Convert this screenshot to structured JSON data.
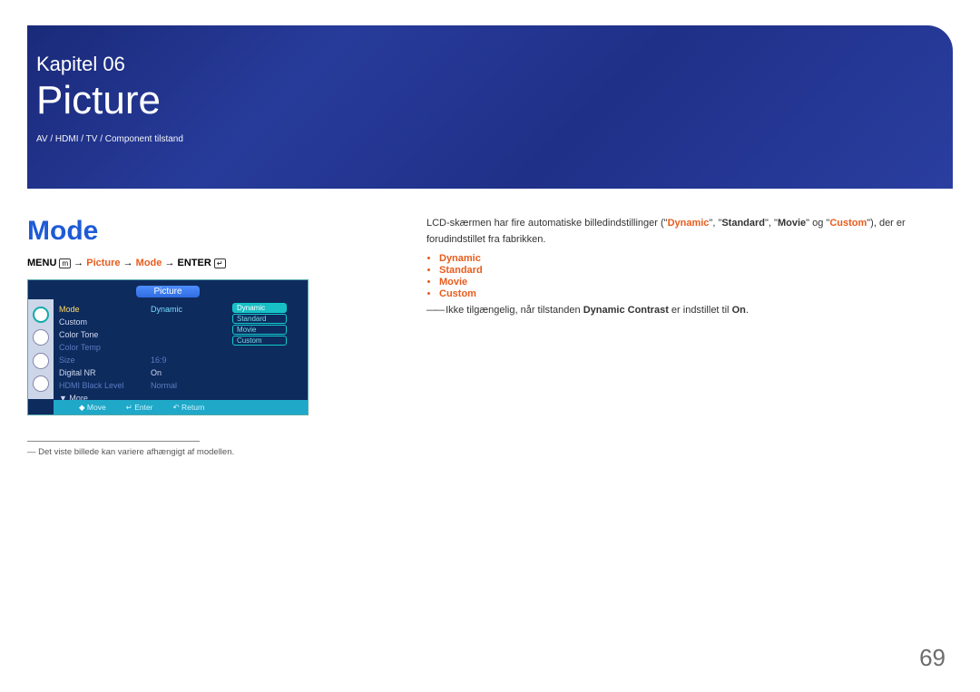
{
  "header": {
    "chapter_label": "Kapitel 06",
    "chapter_title": "Picture",
    "mode_line": "AV / HDMI / TV / Component tilstand"
  },
  "left": {
    "heading": "Mode",
    "path_menu": "MENU",
    "path_picture": "Picture",
    "path_mode": "Mode",
    "path_enter": "ENTER",
    "footnote": "Det viste billede kan variere afhængigt af modellen."
  },
  "osd": {
    "title": "Picture",
    "menu": {
      "mode": "Mode",
      "custom": "Custom",
      "color_tone": "Color Tone",
      "color_temp": "Color Temp",
      "size": "Size",
      "digital_nr": "Digital NR",
      "hdmi_black": "HDMI Black Level",
      "more": "▼ More"
    },
    "vals": {
      "mode": "Dynamic",
      "size": "16:9",
      "digital_nr": "On",
      "hdmi_black": "Normal"
    },
    "opts": {
      "dynamic": "Dynamic",
      "standard": "Standard",
      "movie": "Movie",
      "custom": "Custom"
    },
    "foot": {
      "move": "Move",
      "enter": "Enter",
      "return": "Return"
    }
  },
  "right": {
    "para_pre": "LCD-skærmen har fire automatiske billedindstillinger (\"",
    "w_dynamic": "Dynamic",
    "sep1": "\", \"",
    "w_standard": "Standard",
    "sep2": "\", \"",
    "w_movie": "Movie",
    "sep3": "\" og \"",
    "w_custom": "Custom",
    "para_post": "\"), der er forudindstillet fra fabrikken.",
    "bullets": {
      "b1": "Dynamic",
      "b2": "Standard",
      "b3": "Movie",
      "b4": "Custom"
    },
    "note_pre": "Ikke tilgængelig, når tilstanden ",
    "note_mid": "Dynamic Contrast",
    "note_mid2": " er indstillet til ",
    "note_on": "On",
    "note_dot": "."
  },
  "page_number": "69"
}
